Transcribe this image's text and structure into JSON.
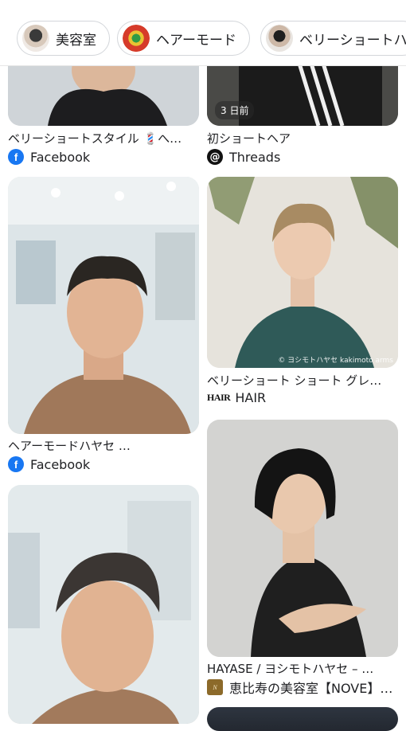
{
  "chips": [
    {
      "label": "美容室"
    },
    {
      "label": "ヘアーモード"
    },
    {
      "label": "ベリーショートハ"
    }
  ],
  "cards": {
    "top_left": {
      "title": "ベリーショートスタイル 💈へ…",
      "source": "Facebook",
      "source_icon": "facebook-icon"
    },
    "top_right": {
      "title": "初ショートヘア",
      "source": "Threads",
      "source_icon": "threads-icon",
      "badge": "3 日前"
    },
    "mid_left": {
      "title": "ヘアーモードハヤセ …",
      "source": "Facebook",
      "source_icon": "facebook-icon"
    },
    "mid_right": {
      "title": "ベリーショート ショート グレ…",
      "source": "HAIR",
      "source_icon": "hair-logo-icon",
      "watermark": "© ヨシモトハヤセ kakimoto arms"
    },
    "low_right": {
      "title": "HAYASE / ヨシモトハヤセ – …",
      "source": "恵比寿の美容室【NOVE】…",
      "source_icon": "nove-logo-icon"
    }
  },
  "colors": {
    "facebook": "#1877f2",
    "chip_border": "#d3d6da"
  }
}
